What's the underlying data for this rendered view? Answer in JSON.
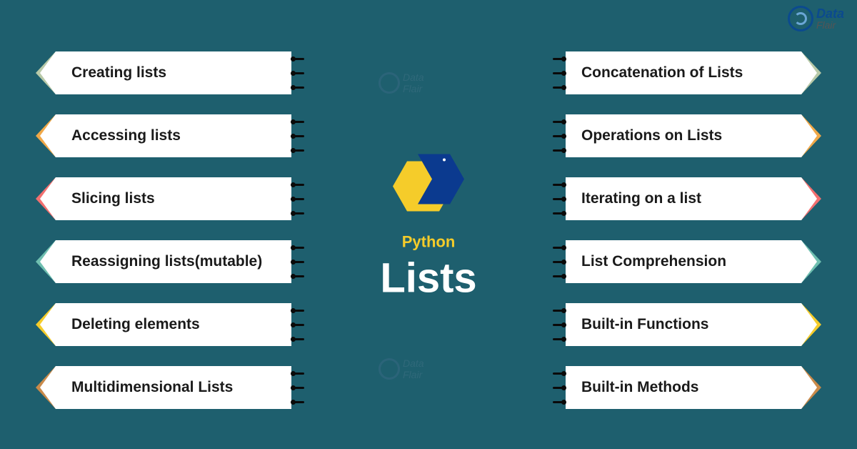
{
  "brand": {
    "line1": "Data",
    "line2": "Flair"
  },
  "center": {
    "language": "Python",
    "title": "Lists"
  },
  "left_items": [
    {
      "label": "Creating lists",
      "accent": "#b8c9a8"
    },
    {
      "label": "Accessing lists",
      "accent": "#f0a848"
    },
    {
      "label": "Slicing lists",
      "accent": "#f27070"
    },
    {
      "label": "Reassigning lists(mutable)",
      "accent": "#6fbfb0"
    },
    {
      "label": "Deleting elements",
      "accent": "#f5cc2a"
    },
    {
      "label": "Multidimensional Lists",
      "accent": "#c98a4a"
    }
  ],
  "right_items": [
    {
      "label": "Concatenation of Lists",
      "accent": "#b8c9a8"
    },
    {
      "label": "Operations on Lists",
      "accent": "#f0a848"
    },
    {
      "label": "Iterating on a list",
      "accent": "#f27070"
    },
    {
      "label": "List Comprehension",
      "accent": "#6fbfb0"
    },
    {
      "label": "Built-in Functions",
      "accent": "#f5cc2a"
    },
    {
      "label": "Built-in Methods",
      "accent": "#c98a4a"
    }
  ]
}
